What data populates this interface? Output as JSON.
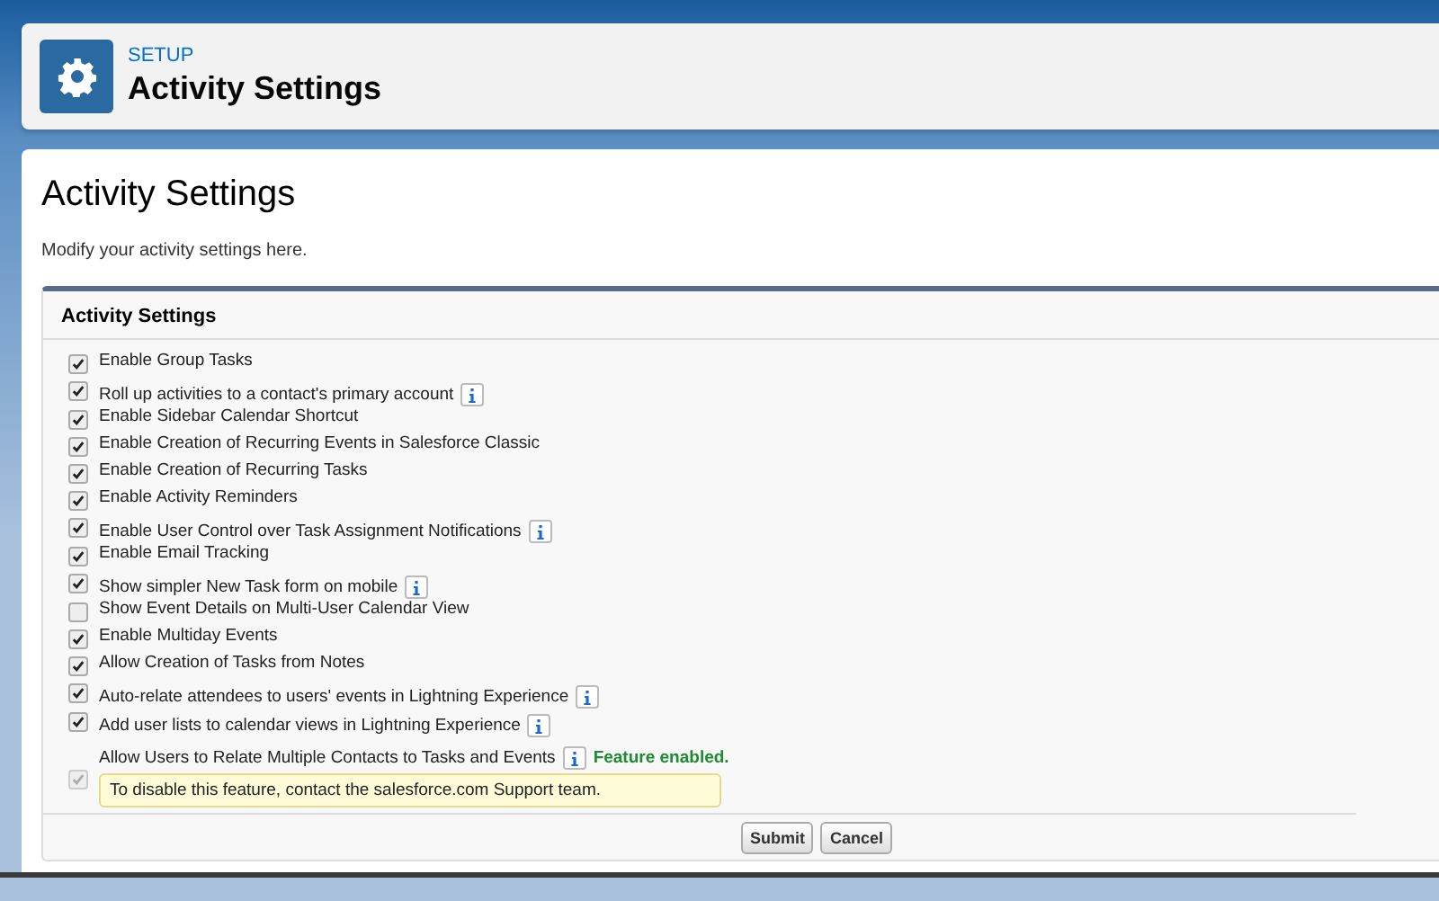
{
  "header": {
    "breadcrumb": "SETUP",
    "title": "Activity Settings"
  },
  "page": {
    "title": "Activity Settings",
    "description": "Modify your activity settings here."
  },
  "section": {
    "title": "Activity Settings",
    "settings": [
      {
        "label": "Enable Group Tasks",
        "checked": true,
        "disabled": false
      },
      {
        "label": "Roll up activities to a contact's primary account",
        "checked": true,
        "disabled": false,
        "info": true
      },
      {
        "label": "Enable Sidebar Calendar Shortcut",
        "checked": true,
        "disabled": false
      },
      {
        "label": "Enable Creation of Recurring Events in Salesforce Classic",
        "checked": true,
        "disabled": false
      },
      {
        "label": "Enable Creation of Recurring Tasks",
        "checked": true,
        "disabled": false
      },
      {
        "label": "Enable Activity Reminders",
        "checked": true,
        "disabled": false
      },
      {
        "label": "Enable User Control over Task Assignment Notifications",
        "checked": true,
        "disabled": false,
        "info": true
      },
      {
        "label": "Enable Email Tracking",
        "checked": true,
        "disabled": false
      },
      {
        "label": "Show simpler New Task form on mobile",
        "checked": true,
        "disabled": false,
        "info": true
      },
      {
        "label": "Show Event Details on Multi-User Calendar View",
        "checked": false,
        "disabled": false
      },
      {
        "label": "Enable Multiday Events",
        "checked": true,
        "disabled": false
      },
      {
        "label": "Allow Creation of Tasks from Notes",
        "checked": true,
        "disabled": false
      },
      {
        "label": "Auto-relate attendees to users' events in Lightning Experience",
        "checked": true,
        "disabled": false,
        "info": true
      },
      {
        "label": "Add user lists to calendar views in Lightning Experience",
        "checked": true,
        "disabled": false,
        "info": true
      },
      {
        "label": "Allow Users to Relate Multiple Contacts to Tasks and Events",
        "checked": true,
        "disabled": true,
        "info": true,
        "status": "Feature enabled.",
        "note": "To disable this feature, contact the salesforce.com Support team."
      }
    ],
    "buttons": [
      "Submit",
      "Cancel"
    ]
  }
}
